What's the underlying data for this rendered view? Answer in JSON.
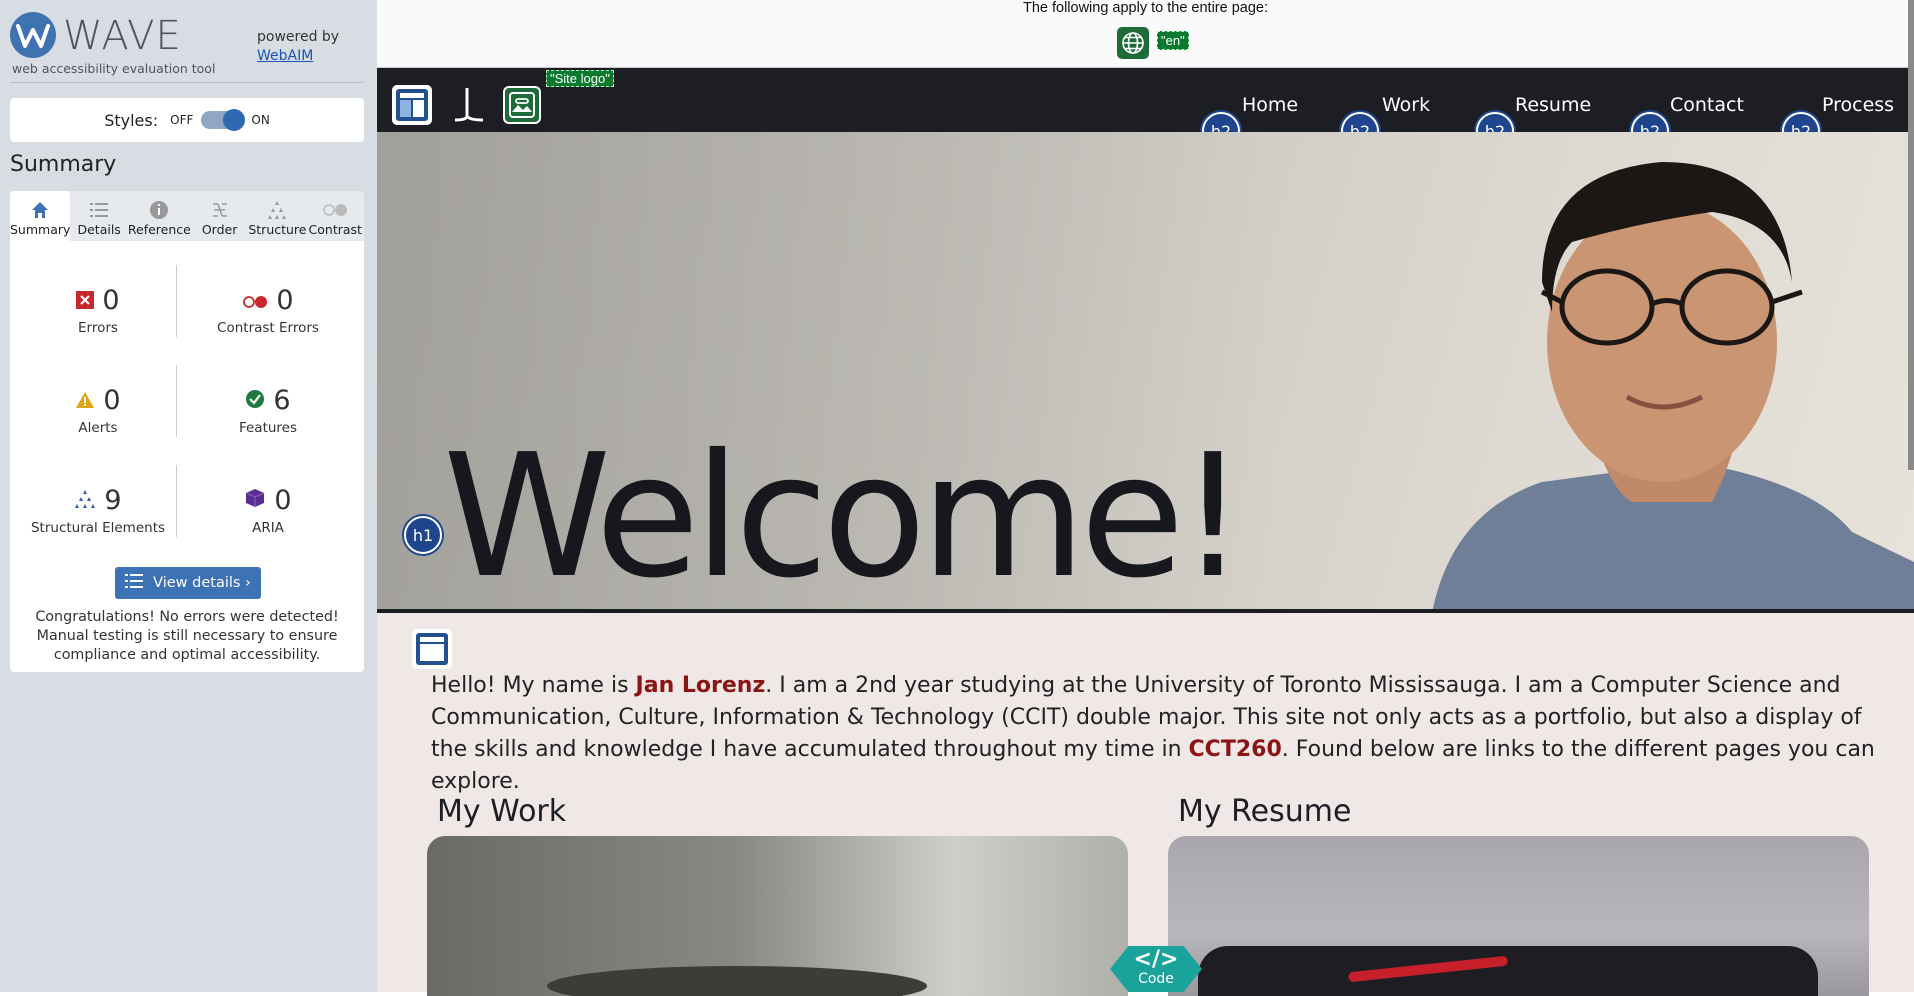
{
  "wave": {
    "title": "WAVE",
    "subtitle": "web accessibility evaluation tool",
    "powered_by": "powered by",
    "webaim_link": "WebAIM",
    "styles_label": "Styles:",
    "styles_off": "OFF",
    "styles_on": "ON",
    "summary_heading": "Summary",
    "tabs": [
      {
        "label": "Summary",
        "icon": "home-icon",
        "active": true
      },
      {
        "label": "Details",
        "icon": "list-icon",
        "active": false
      },
      {
        "label": "Reference",
        "icon": "info-icon",
        "active": false
      },
      {
        "label": "Order",
        "icon": "order-icon",
        "active": false
      },
      {
        "label": "Structure",
        "icon": "structure-icon",
        "active": false
      },
      {
        "label": "Contrast",
        "icon": "contrast-icon",
        "active": false
      }
    ],
    "stats": {
      "errors": {
        "count": "0",
        "label": "Errors"
      },
      "contrast_errors": {
        "count": "0",
        "label": "Contrast Errors"
      },
      "alerts": {
        "count": "0",
        "label": "Alerts"
      },
      "features": {
        "count": "6",
        "label": "Features"
      },
      "structural": {
        "count": "9",
        "label": "Structural Elements"
      },
      "aria": {
        "count": "0",
        "label": "ARIA"
      }
    },
    "view_details": "View details ›",
    "congrats": "Congratulations! No errors were detected! Manual testing is still necessary to ensure compliance and optimal accessibility."
  },
  "page": {
    "doc_notice": "The following apply to the entire page:",
    "lang_tag": "\"en\"",
    "site_logo_alt": "\"Site logo\"",
    "nav": [
      "Home",
      "Work",
      "Resume",
      "Contact",
      "Process"
    ],
    "h2_label": "h2",
    "h1_label": "h1",
    "hero_title": "Welcome!",
    "intro": {
      "part1": "Hello! My name is ",
      "name": "Jan Lorenz",
      "part2": ". I am a 2nd year studying at the University of Toronto Mississauga. I am a Computer Science and Communication, Culture, Information & Technology (CCIT) double major. This site not only acts as a portfolio, but also a display of the skills and knowledge I have accumulated throughout my time in ",
      "course": "CCT260",
      "part3": ". Found below are links to the different pages you can explore."
    },
    "cards": [
      "My Work",
      "My Resume"
    ],
    "code_badge": "Code"
  },
  "colors": {
    "wave_blue": "#3f72b0",
    "nav_bg": "#1d1e24",
    "page_bg": "#efe8e7",
    "highlight": "#8c1414",
    "feature_green": "#1e6b3a"
  }
}
